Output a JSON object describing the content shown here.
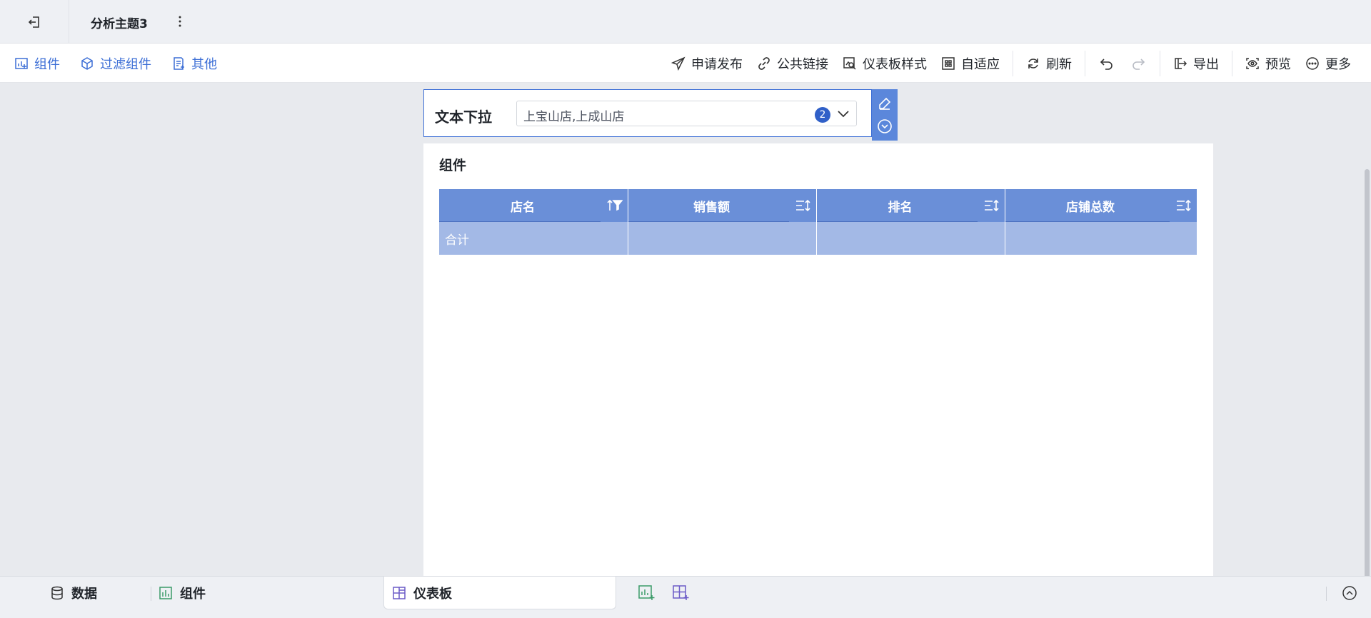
{
  "header": {
    "title": "分析主题3"
  },
  "toolbar": {
    "left": [
      {
        "label": "组件",
        "icon": "add-chart-icon"
      },
      {
        "label": "过滤组件",
        "icon": "filter-component-icon"
      },
      {
        "label": "其他",
        "icon": "other-icon"
      }
    ],
    "right": {
      "publish": "申请发布",
      "public_link": "公共链接",
      "dashboard_style": "仪表板样式",
      "adaptive": "自适应",
      "refresh": "刷新",
      "export": "导出",
      "preview": "预览",
      "more": "更多"
    }
  },
  "filter": {
    "label": "文本下拉",
    "value": "上宝山店,上成山店",
    "selected_count": "2"
  },
  "table_widget": {
    "title": "组件",
    "columns": [
      {
        "label": "店名",
        "icon": "sort-filter-icon"
      },
      {
        "label": "销售额",
        "icon": "sort-icon"
      },
      {
        "label": "排名",
        "icon": "sort-icon"
      },
      {
        "label": "店铺总数",
        "icon": "sort-icon"
      }
    ],
    "rows": [
      [
        "合计",
        "",
        "",
        ""
      ]
    ],
    "header_color": "#6a8fd8",
    "row_color": "#a3b9e6"
  },
  "bottom": {
    "tabs": {
      "data": "数据",
      "component": "组件",
      "dashboard": "仪表板"
    }
  },
  "colors": {
    "accent": "#3d6fd6"
  }
}
